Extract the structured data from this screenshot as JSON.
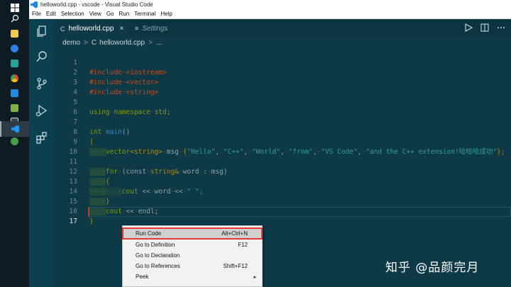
{
  "window": {
    "title": "helloworld.cpp - vscode - Visual Studio Code"
  },
  "menubar": {
    "items": [
      "File",
      "Edit",
      "Selection",
      "View",
      "Go",
      "Run",
      "Terminal",
      "Help"
    ]
  },
  "taskbar": {
    "icons": [
      "windows-start-icon",
      "search-icon",
      "file-explorer-icon",
      "app-icon",
      "bing-icon",
      "chrome-icon",
      "app-icon",
      "notepad-icon",
      "terminal-icon",
      "vscode-icon",
      "wechat-icon"
    ]
  },
  "activity_bar": {
    "icons": [
      "explorer-icon",
      "search-icon",
      "source-control-icon",
      "run-debug-icon",
      "extensions-icon"
    ]
  },
  "tabs": [
    {
      "label": "helloworld.cpp",
      "icon": "C",
      "active": true,
      "close": "×"
    },
    {
      "label": "Settings",
      "icon": "≡",
      "active": false
    }
  ],
  "breadcrumb": {
    "folder": "demo",
    "separator": ">",
    "file_icon": "C",
    "file": "helloworld.cpp",
    "tail": "..."
  },
  "editor": {
    "current_line": 17,
    "lines": [
      {
        "n": "1"
      },
      {
        "n": "2"
      },
      {
        "n": "3"
      },
      {
        "n": "4"
      },
      {
        "n": "5"
      },
      {
        "n": "6"
      },
      {
        "n": "7"
      },
      {
        "n": "8"
      },
      {
        "n": "9"
      },
      {
        "n": "10"
      },
      {
        "n": "11"
      },
      {
        "n": "12"
      },
      {
        "n": "13"
      },
      {
        "n": "14"
      },
      {
        "n": "15"
      },
      {
        "n": "16"
      },
      {
        "n": "17"
      }
    ],
    "tokens": {
      "l1a": "#include",
      "l1b": "<iostream>",
      "l2a": "#include",
      "l2b": "<vector>",
      "l3a": "#include",
      "l3b": "<string>",
      "l5a": "using",
      "l5b": "namespace",
      "l5c": "std;",
      "l7a": "int",
      "l7b": "main",
      "l7c": "()",
      "l8a": "{",
      "l9a": "vector",
      "l9b": "<string>",
      "l9c": "msg",
      "l9d": "{",
      "l9e": "\"Hello\"",
      "l9f": "\"C++\"",
      "l9g": "\"World\"",
      "l9h": "\"from\"",
      "l9i": "\"VS Code\"",
      "l9j": "\"and the C++ extension!哈哈哈成功\"",
      "l9k": "};",
      "l11a": "for",
      "l11b": "(const",
      "l11c": "string&",
      "l11d": "word",
      "l11e": ":",
      "l11f": "msg)",
      "l12a": "{",
      "l13a": "cout",
      "l13b": "<<",
      "l13c": "word",
      "l13d": "<<",
      "l13e": "\" \";",
      "l14a": "}",
      "l15a": "cout",
      "l15b": "<<",
      "l15c": "endl;",
      "l16a": "}"
    }
  },
  "context_menu": {
    "items": [
      {
        "label": "Run Code",
        "shortcut": "Alt+Ctrl+N"
      },
      {
        "label": "Go to Definition",
        "shortcut": "F12"
      },
      {
        "label": "Go to Declaration",
        "shortcut": ""
      },
      {
        "label": "Go to References",
        "shortcut": "Shift+F12"
      },
      {
        "label": "Peek",
        "shortcut": ""
      }
    ],
    "submenu_arrow": "▸"
  },
  "watermark": "知乎 @品颜完月",
  "colors": {
    "editor_bg": "#0e3a47",
    "activity_bg": "#0b4050",
    "highlight_outline": "#e53935"
  }
}
